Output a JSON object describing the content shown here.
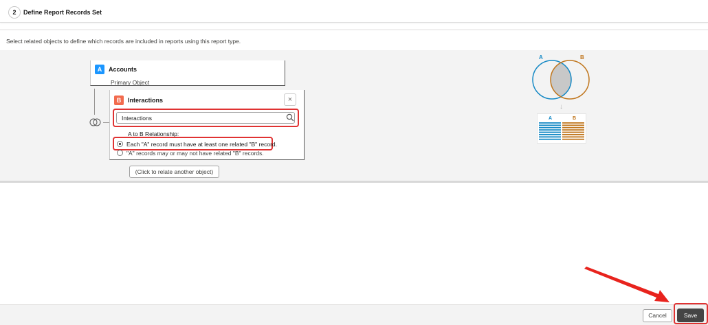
{
  "step": {
    "number": "2",
    "title": "Define Report Records Set"
  },
  "instructions": "Select related objects to define which records are included in reports using this report type.",
  "object_a": {
    "badge": "A",
    "name": "Accounts",
    "subtitle": "Primary Object"
  },
  "object_b": {
    "badge": "B",
    "name": "Interactions",
    "close_symbol": "×",
    "search_value": "Interactions",
    "relationship_label": "A to B Relationship:",
    "options": [
      {
        "label": "Each \"A\" record must have at least one related \"B\" record.",
        "selected": true
      },
      {
        "label": "\"A\" records may or may not have related \"B\" records.",
        "selected": false
      }
    ]
  },
  "relate_button": "(Click to relate another object)",
  "venn": {
    "label_a": "A",
    "label_b": "B",
    "arrow": "↓",
    "records_a": "A",
    "records_b": "B",
    "color_a": "#1589c5",
    "color_b": "#c0761d"
  },
  "footer": {
    "cancel": "Cancel",
    "save": "Save"
  },
  "colors": {
    "highlight": "#e03232",
    "badge_a": "#1b96ff",
    "badge_b": "#f26b4e"
  }
}
